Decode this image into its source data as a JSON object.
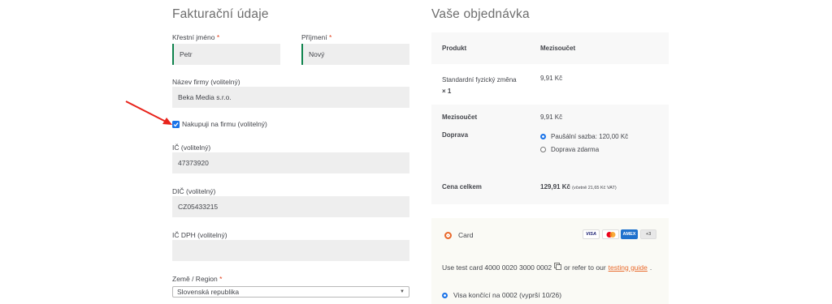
{
  "billing": {
    "title": "Fakturační údaje",
    "first_name_label": "Křestní jméno",
    "first_name_value": "Petr",
    "last_name_label": "Příjmení",
    "last_name_value": "Nový",
    "required_mark": "*",
    "company_label": "Název firmy (volitelný)",
    "company_value": "Beka Media s.r.o.",
    "buy_as_company_label": "Nakupuji na firmu (volitelný)",
    "ico_label": "IČ (volitelný)",
    "ico_value": "47373920",
    "dic_label": "DIČ (volitelný)",
    "dic_value": "CZ05433215",
    "icdph_label": "IČ DPH (volitelný)",
    "icdph_value": "",
    "country_label": "Země / Region",
    "country_value": "Slovenská republika"
  },
  "order": {
    "title": "Vaše objednávka",
    "col_product": "Produkt",
    "col_subtotal": "Mezisoučet",
    "item_name": "Standardní fyzický změna",
    "item_qty": "× 1",
    "item_price": "9,91 Kč",
    "subtotal_label": "Mezisoučet",
    "subtotal_value": "9,91 Kč",
    "shipping_label": "Doprava",
    "shipping_option1": "Paušální sazba: 120,00 Kč",
    "shipping_option2": "Doprava zdarma",
    "total_label": "Cena celkem",
    "total_value": "129,91 Kč",
    "total_vat_note": "(včetně 21,65 Kč VAT)"
  },
  "payment": {
    "method_label": "Card",
    "card_icons": [
      "VISA",
      "",
      "AMEX",
      "+3"
    ],
    "test_text_prefix": "Use test card 4000 0020 3000 0002",
    "test_text_middle": "or refer to our",
    "test_link": "testing guide",
    "test_text_suffix": ".",
    "saved_card": "Visa končící na 0002 (vyprší 10/26)"
  },
  "colors": {
    "accent_orange": "#e96a2c",
    "annotation_arrow": "#e8231b",
    "focus_green": "#0f834d"
  }
}
